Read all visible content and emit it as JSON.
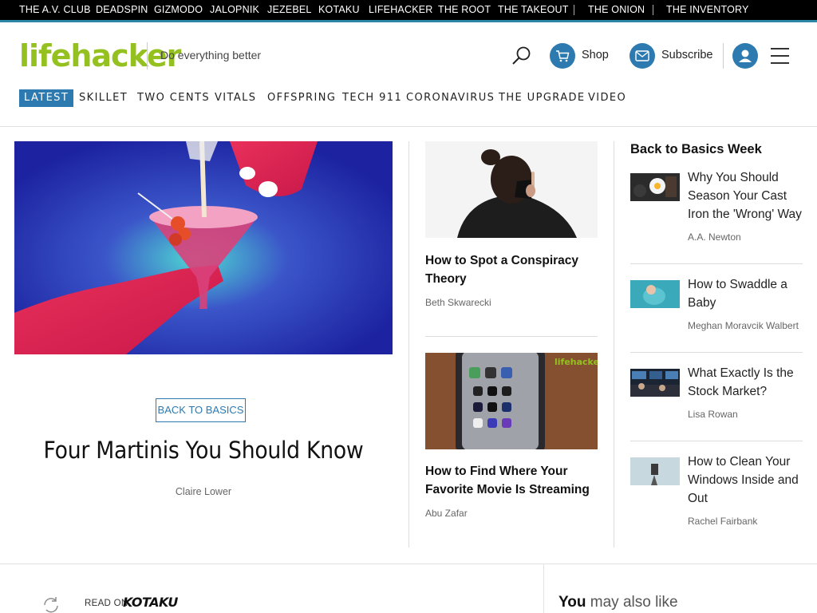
{
  "network_bar": {
    "links": [
      "THE A.V. CLUB",
      "DEADSPIN",
      "GIZMODO",
      "JALOPNIK",
      "JEZEBEL",
      "KOTAKU",
      "LIFEHACKER",
      "THE ROOT",
      "THE TAKEOUT",
      "THE ONION",
      "THE INVENTORY"
    ]
  },
  "header": {
    "logo_part1": "life",
    "logo_part2": "hacker",
    "tagline": "Do everything better",
    "shop_label": "Shop",
    "subscribe_label": "Subscribe",
    "icons": [
      "search-icon",
      "cart-icon",
      "mail-icon",
      "user-icon",
      "menu-icon"
    ]
  },
  "nav": {
    "items": [
      "LATEST",
      "SKILLET",
      "TWO CENTS",
      "VITALS",
      "OFFSPRING",
      "TECH 911",
      "CORONAVIRUS",
      "THE UPGRADE",
      "VIDEO"
    ],
    "active": "LATEST"
  },
  "hero": {
    "tag": "BACK TO BASICS",
    "title": "Four Martinis You Should Know",
    "author": "Claire Lower"
  },
  "middle": {
    "cards": [
      {
        "title": "How to Spot a Conspiracy Theory",
        "author": "Beth Skwarecki"
      },
      {
        "title": "How to Find Where Your Favorite Movie Is Streaming",
        "author": "Abu Zafar",
        "thumb_watermark": "lifehacker"
      }
    ]
  },
  "right": {
    "heading": "Back to Basics Week",
    "items": [
      {
        "title": "Why You Should Season Your Cast Iron the 'Wrong' Way",
        "author": "A.A. Newton"
      },
      {
        "title": "How to Swaddle a Baby",
        "author": "Meghan Moravcik Walbert"
      },
      {
        "title": "What Exactly Is the Stock Market?",
        "author": "Lisa Rowan"
      },
      {
        "title": "How to Clean Your Windows Inside and Out",
        "author": "Rachel Fairbank"
      }
    ]
  },
  "bottom": {
    "read_on": "READ ON",
    "partner": "KOTAKU",
    "also_like_bold": "You",
    "also_like_rest": "may also like"
  },
  "colors": {
    "accent": "#2c7ab0",
    "logo_green": "#94c11f",
    "network_bg": "#000000"
  }
}
